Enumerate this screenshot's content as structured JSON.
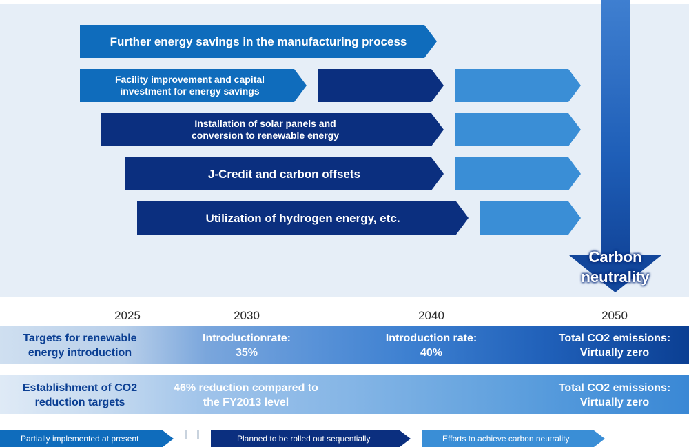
{
  "measures": [
    {
      "label": "Further energy savings in the manufacturing process"
    },
    {
      "label": "Facility improvement and capital investment for energy savings"
    },
    {
      "label": "Installation of solar panels and conversion to renewable energy"
    },
    {
      "label": "J-Credit and carbon offsets"
    },
    {
      "label": "Utilization of hydrogen energy, etc."
    }
  ],
  "goal": {
    "label": "Carbon neutrality"
  },
  "years": [
    "2025",
    "2030",
    "2040",
    "2050"
  ],
  "renewable_row": {
    "title": "Targets for renewable energy introduction",
    "v2030": "Introductionrate: 35%",
    "v2040": "Introduction rate: 40%",
    "v2050": "Total CO2 emissions: Virtually zero"
  },
  "co2_row": {
    "title": "Establishment of CO2 reduction targets",
    "v2030": "46% reduction compared to the FY2013 level",
    "v2050": "Total CO2 emissions: Virtually zero"
  },
  "legend": [
    {
      "label": "Partially implemented at present",
      "color": "#0f6cbc"
    },
    {
      "label": "Planned to be rolled out sequentially",
      "color": "#0b2f7f"
    },
    {
      "label": "Efforts to achieve carbon neutrality",
      "color": "#3a8ed6"
    }
  ]
}
